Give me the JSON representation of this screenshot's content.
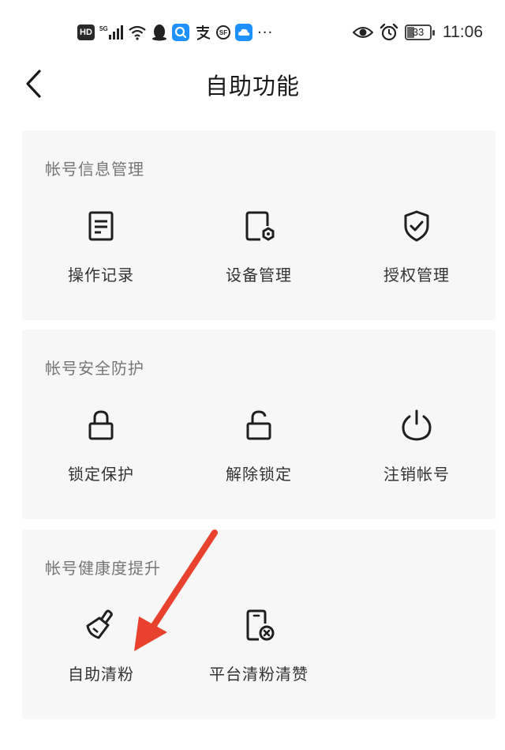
{
  "status_bar": {
    "hd_label": "HD",
    "network_label": "5G",
    "sf_label": "SF",
    "more": "···",
    "battery_level": "33",
    "time": "11:06",
    "icons": [
      "hd-icon",
      "signal-5g-icon",
      "wifi-icon",
      "qq-icon",
      "search-app-icon",
      "alipay-icon",
      "sf-express-icon",
      "weather-app-icon",
      "more-notifications-icon",
      "eye-care-icon",
      "alarm-icon",
      "battery-icon"
    ]
  },
  "header": {
    "title": "自助功能",
    "back_icon": "chevron-left-icon"
  },
  "sections": [
    {
      "title": "帐号信息管理",
      "items": [
        {
          "label": "操作记录",
          "icon": "document-icon"
        },
        {
          "label": "设备管理",
          "icon": "device-settings-icon"
        },
        {
          "label": "授权管理",
          "icon": "shield-check-icon"
        }
      ]
    },
    {
      "title": "帐号安全防护",
      "items": [
        {
          "label": "锁定保护",
          "icon": "lock-icon"
        },
        {
          "label": "解除锁定",
          "icon": "unlock-icon"
        },
        {
          "label": "注销帐号",
          "icon": "power-icon"
        }
      ]
    },
    {
      "title": "帐号健康度提升",
      "items": [
        {
          "label": "自助清粉",
          "icon": "broom-icon"
        },
        {
          "label": "平台清粉清赞",
          "icon": "phone-remove-icon"
        }
      ]
    }
  ],
  "annotation": {
    "type": "arrow",
    "color": "#e8412e",
    "target": "自助清粉"
  },
  "colors": {
    "card_bg": "#f7f7f7",
    "section_title": "#767676",
    "icon_stroke": "#1f1f1f"
  }
}
